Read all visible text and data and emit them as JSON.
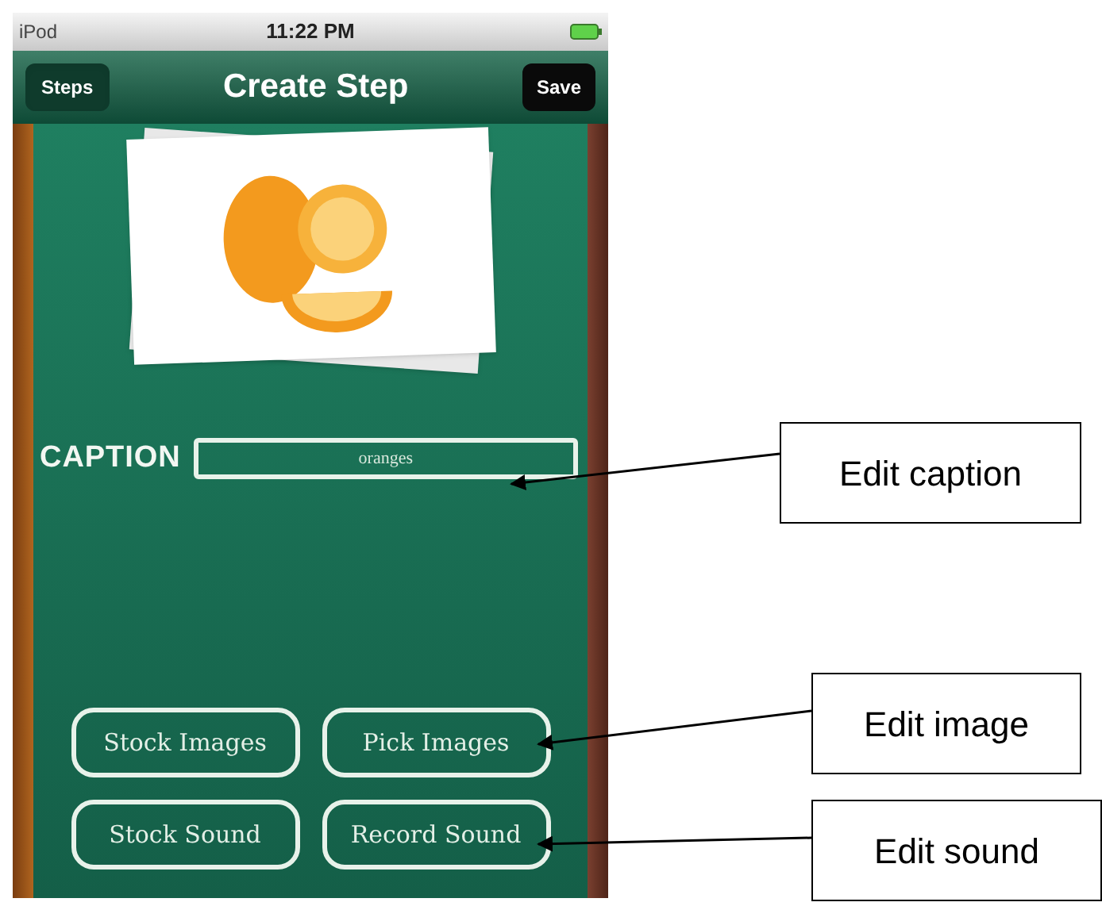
{
  "status_bar": {
    "carrier": "iPod",
    "time": "11:22 PM"
  },
  "nav_bar": {
    "back_button": "Steps",
    "title": "Create Step",
    "save_button": "Save"
  },
  "caption": {
    "label": "CAPTION",
    "value": "oranges"
  },
  "buttons": [
    {
      "label": "Stock Images"
    },
    {
      "label": "Pick Images"
    },
    {
      "label": "Stock Sound"
    },
    {
      "label": "Record Sound"
    }
  ],
  "callouts": [
    {
      "label": "Edit caption"
    },
    {
      "label": "Edit image"
    },
    {
      "label": "Edit sound"
    }
  ]
}
